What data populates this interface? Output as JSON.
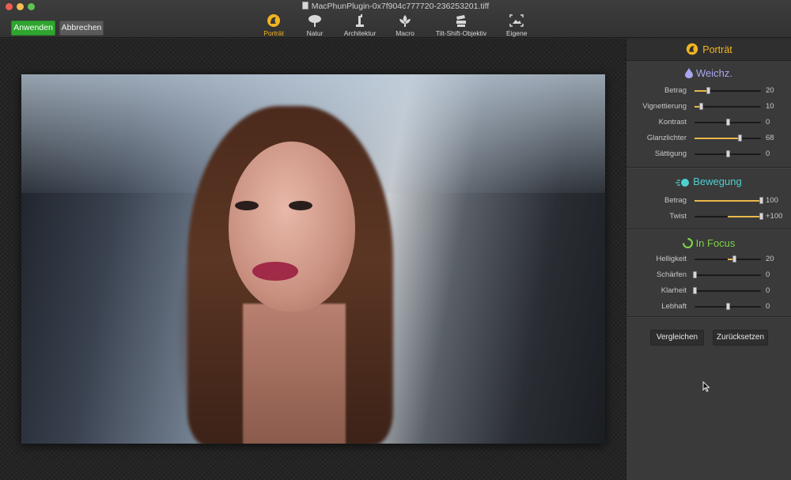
{
  "window": {
    "title": "MacPhunPlugin-0x7f904c777720-236253201.tiff"
  },
  "toolbar": {
    "apply_label": "Anwenden",
    "cancel_label": "Abbrechen",
    "tools": [
      {
        "label": "Porträt",
        "icon": "portrait-icon",
        "active": true
      },
      {
        "label": "Natur",
        "icon": "tree-icon",
        "active": false
      },
      {
        "label": "Architektur",
        "icon": "statue-icon",
        "active": false
      },
      {
        "label": "Macro",
        "icon": "flower-icon",
        "active": false
      },
      {
        "label": "Tilt-Shift-Objektiv",
        "icon": "lens-icon",
        "active": false
      },
      {
        "label": "Eigene",
        "icon": "custom-frame-icon",
        "active": false
      }
    ]
  },
  "panel": {
    "header": "Porträt",
    "accent_color": "#f2b521",
    "sections": [
      {
        "title": "Weichz.",
        "icon": "drop-icon",
        "color": "#a9a6f0",
        "sliders": [
          {
            "label": "Betrag",
            "value": "20",
            "fraction": 0.2,
            "origin": "left"
          },
          {
            "label": "Vignettierung",
            "value": "10",
            "fraction": 0.1,
            "origin": "left"
          },
          {
            "label": "Kontrast",
            "value": "0",
            "fraction": 0.5,
            "origin": "center"
          },
          {
            "label": "Glanzlichter",
            "value": "68",
            "fraction": 0.68,
            "origin": "left"
          },
          {
            "label": "Sättigung",
            "value": "0",
            "fraction": 0.5,
            "origin": "center"
          }
        ]
      },
      {
        "title": "Bewegung",
        "icon": "motion-icon",
        "color": "#4fd0d0",
        "sliders": [
          {
            "label": "Betrag",
            "value": "100",
            "fraction": 1.0,
            "origin": "left"
          },
          {
            "label": "Twist",
            "value": "+100",
            "fraction": 1.0,
            "origin": "center"
          }
        ]
      },
      {
        "title": "In Focus",
        "icon": "refresh-icon",
        "color": "#7ed04a",
        "sliders": [
          {
            "label": "Helligkeit",
            "value": "20",
            "fraction": 0.6,
            "origin": "center"
          },
          {
            "label": "Schärfen",
            "value": "0",
            "fraction": 0.0,
            "origin": "left"
          },
          {
            "label": "Klarheit",
            "value": "0",
            "fraction": 0.0,
            "origin": "left"
          },
          {
            "label": "Lebhaft",
            "value": "0",
            "fraction": 0.5,
            "origin": "center"
          }
        ]
      }
    ],
    "compare_label": "Vergleichen",
    "reset_label": "Zurücksetzen"
  }
}
